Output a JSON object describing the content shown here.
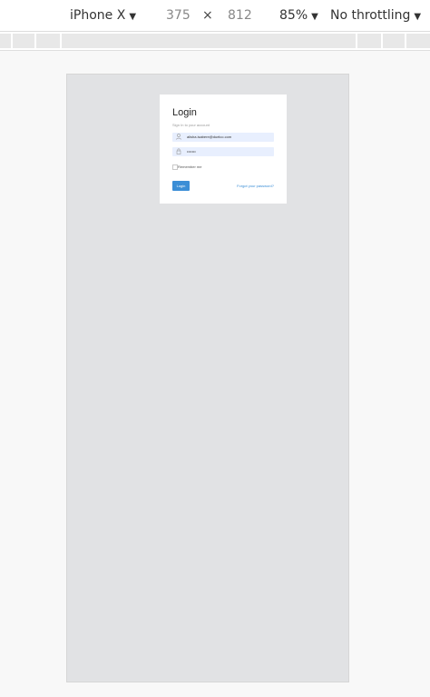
{
  "devtools": {
    "device": "iPhone X",
    "width": "375",
    "times": "×",
    "height": "812",
    "zoom": "85%",
    "throttling": "No throttling",
    "caret_icon": "▼"
  },
  "login": {
    "title": "Login",
    "subtitle": "Sign In to your account",
    "email_value": "alisha.isabere@duelco.com",
    "password_value": "•••••••",
    "remember_label": "Remember me",
    "login_button": "Login",
    "forgot_link": "Forgot your password?",
    "accent_color": "#3b8ed6",
    "field_background": "#e8effe"
  }
}
